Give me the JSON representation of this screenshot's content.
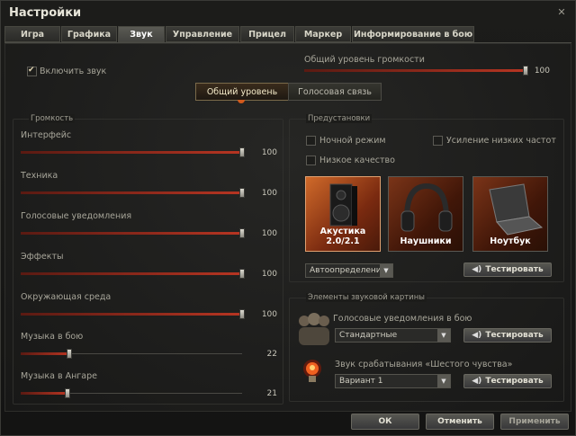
{
  "window": {
    "title": "Настройки",
    "close": "✕"
  },
  "tabs": [
    "Игра",
    "Графика",
    "Звук",
    "Управление",
    "Прицел",
    "Маркер",
    "Информирование в бою"
  ],
  "active_tab": "Звук",
  "enable_sound": {
    "label": "Включить звук",
    "checked": true
  },
  "master": {
    "label": "Общий уровень громкости",
    "value": "100",
    "level": 1.0
  },
  "mode_tabs": {
    "general": "Общий уровень",
    "voice": "Голосовая связь"
  },
  "volume": {
    "title": "Громкость",
    "items": [
      {
        "label": "Интерфейс",
        "value": "100",
        "level": 1.0
      },
      {
        "label": "Техника",
        "value": "100",
        "level": 1.0
      },
      {
        "label": "Голосовые уведомления",
        "value": "100",
        "level": 1.0
      },
      {
        "label": "Эффекты",
        "value": "100",
        "level": 1.0
      },
      {
        "label": "Окружающая среда",
        "value": "100",
        "level": 1.0
      },
      {
        "label": "Музыка в бою",
        "value": "22",
        "level": 0.22
      },
      {
        "label": "Музыка в Ангаре",
        "value": "21",
        "level": 0.21
      }
    ]
  },
  "presets": {
    "title": "Предустановки",
    "night": "Ночной режим",
    "bass": "Усиление низких частот",
    "low": "Низкое качество",
    "cards": [
      "Акустика 2.0/2.1",
      "Наушники",
      "Ноутбук"
    ],
    "detect": "Автоопределение",
    "test": "Тестировать"
  },
  "elements": {
    "title": "Элементы звуковой картины",
    "voice_label": "Голосовые уведомления в бою",
    "voice_value": "Стандартные",
    "sixth_label": "Звук срабатывания «Шестого чувства»",
    "sixth_value": "Вариант 1",
    "test": "Тестировать"
  },
  "footer": {
    "ok": "ОК",
    "cancel": "Отменить",
    "apply": "Применить"
  }
}
